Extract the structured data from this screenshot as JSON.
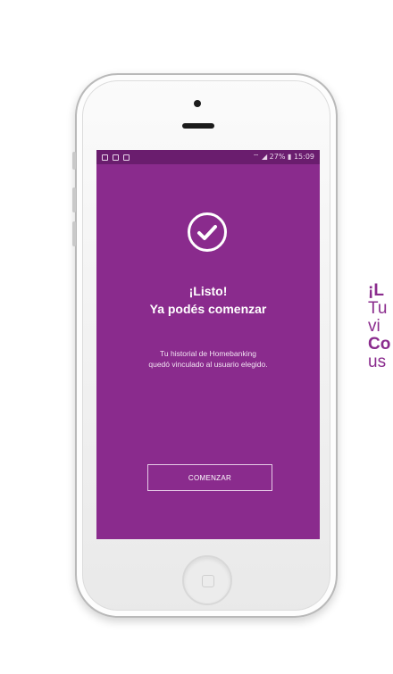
{
  "status_bar": {
    "right_text": "27%",
    "time": "15:09"
  },
  "screen": {
    "title_line1": "¡Listo!",
    "title_line2": "Ya podés comenzar",
    "message_line1": "Tu historial de Homebanking",
    "message_line2": "quedó vinculado al usuario elegido.",
    "button_label": "COMENZAR"
  },
  "side_text": {
    "line1": "¡L",
    "line2": "Tu",
    "line3": "vi",
    "line4": "Co",
    "line5": "us"
  },
  "colors": {
    "brand_purple": "#8a2b8d",
    "statusbar": "#6a1d6e"
  }
}
